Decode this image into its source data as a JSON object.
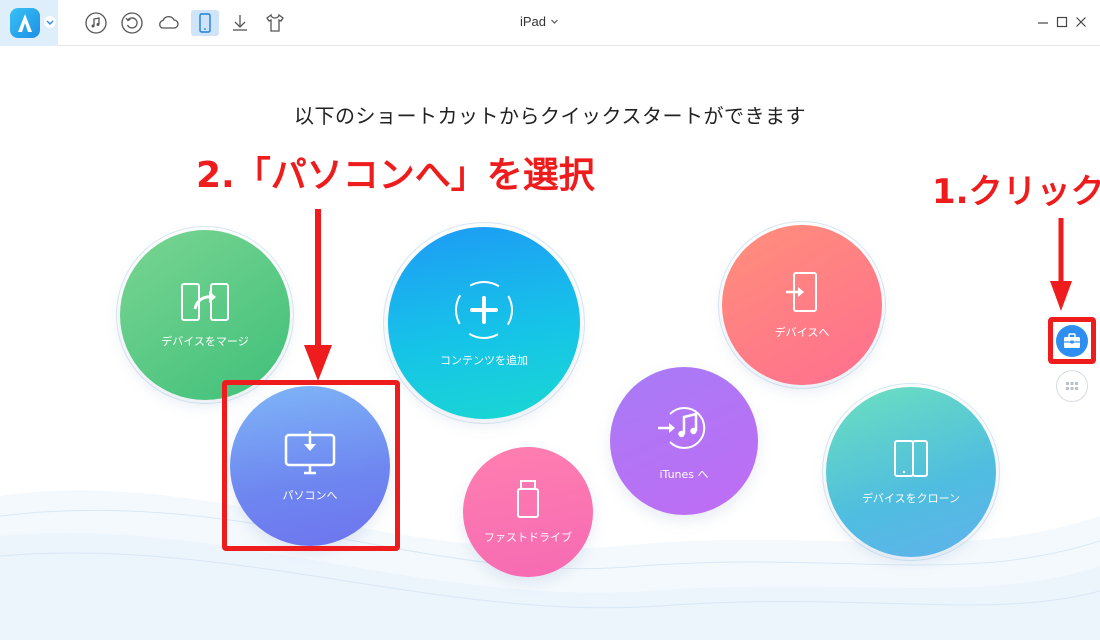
{
  "toolbar": {
    "logo_icon": "app-logo-icon",
    "icons": [
      "music-icon",
      "history-icon",
      "cloud-icon",
      "phone-icon",
      "download-icon",
      "tshirt-icon"
    ],
    "active_icon": "phone-icon",
    "device_name": "iPad",
    "accent": "#2f8ff0"
  },
  "main": {
    "heading": "以下のショートカットからクイックスタートができます",
    "shortcuts": {
      "merge": "デバイスをマージ",
      "add_content": "コンテンツを追加",
      "to_device": "デバイスへ",
      "to_pc": "パソコンへ",
      "itunes": "iTunes へ",
      "fast_drive": "ファストドライブ",
      "clone": "デバイスをクローン"
    }
  },
  "side": {
    "toolbox_icon": "toolbox-icon",
    "grid_icon": "grid-icon"
  },
  "annotations": {
    "step2": "2.「パソコンへ」を選択",
    "step1": "1.クリック",
    "color": "#ee1c1c"
  }
}
